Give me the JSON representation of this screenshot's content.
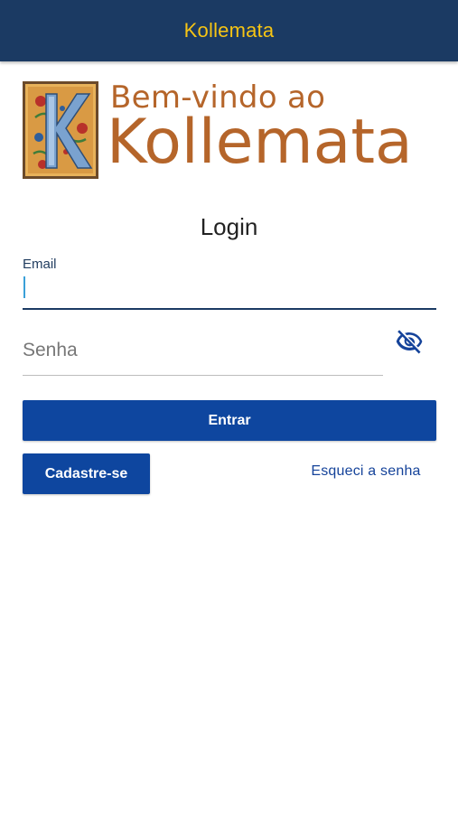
{
  "appbar": {
    "title": "Kollemata"
  },
  "logo": {
    "initial": "K",
    "welcome": "Bem-vindo ao",
    "brand": "Kollemata",
    "colors": {
      "text": "#b5652a",
      "tile_bg": "#e8b25a",
      "tile_frame": "#6b4a2a"
    }
  },
  "form": {
    "title": "Login",
    "email": {
      "label": "Email",
      "value": ""
    },
    "password": {
      "placeholder": "Senha",
      "value": "",
      "toggle_icon": "eye-off-icon"
    }
  },
  "buttons": {
    "login": "Entrar",
    "signup": "Cadastre-se",
    "forgot": "Esqueci a senha"
  },
  "colors": {
    "appbar_bg": "#1b3a63",
    "appbar_title": "#f6c414",
    "button_bg": "#0e469f",
    "link": "#15439a"
  }
}
